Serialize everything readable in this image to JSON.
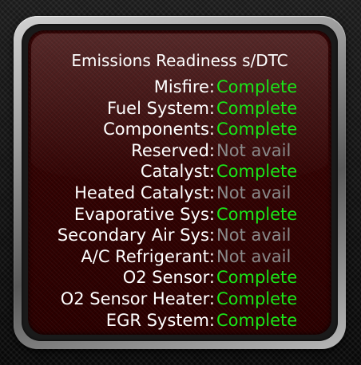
{
  "screen": {
    "title": "Emissions Readiness s/DTC"
  },
  "colors": {
    "complete": "#19e619",
    "not_avail": "#8a8a8a",
    "label": "#ffffff",
    "panel": "#2b0000"
  },
  "monitors": [
    {
      "label": "Misfire:",
      "status": "Complete",
      "state": "complete"
    },
    {
      "label": "Fuel System:",
      "status": "Complete",
      "state": "complete"
    },
    {
      "label": "Components:",
      "status": "Complete",
      "state": "complete"
    },
    {
      "label": "Reserved:",
      "status": "Not avail",
      "state": "not-avail"
    },
    {
      "label": "Catalyst:",
      "status": "Complete",
      "state": "complete"
    },
    {
      "label": "Heated Catalyst:",
      "status": "Not avail",
      "state": "not-avail"
    },
    {
      "label": "Evaporative Sys:",
      "status": "Complete",
      "state": "complete"
    },
    {
      "label": "Secondary Air Sys:",
      "status": "Not avail",
      "state": "not-avail"
    },
    {
      "label": "A/C Refrigerant:",
      "status": "Not avail",
      "state": "not-avail"
    },
    {
      "label": "O2 Sensor:",
      "status": "Complete",
      "state": "complete"
    },
    {
      "label": "O2 Sensor Heater:",
      "status": "Complete",
      "state": "complete"
    },
    {
      "label": "EGR System:",
      "status": "Complete",
      "state": "complete"
    }
  ]
}
